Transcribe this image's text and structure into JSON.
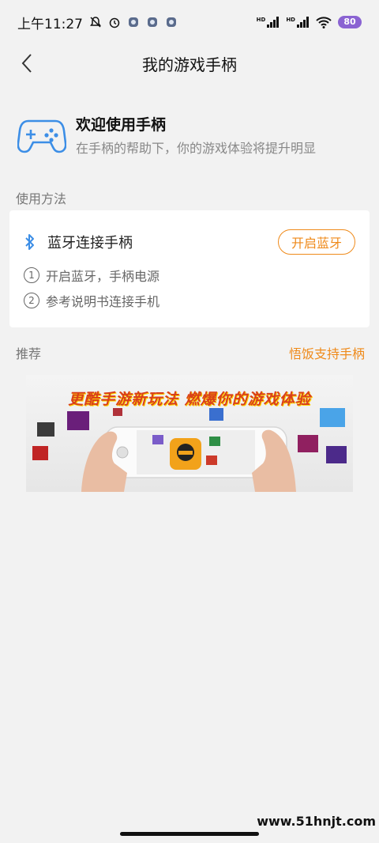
{
  "status_bar": {
    "time": "上午11:27",
    "network_badges": [
      "HD",
      "HD"
    ],
    "battery": "80"
  },
  "nav": {
    "title": "我的游戏手柄"
  },
  "welcome": {
    "title": "欢迎使用手柄",
    "subtitle": "在手柄的帮助下，你的游戏体验将提升明显"
  },
  "usage": {
    "section_label": "使用方法",
    "bluetooth_label": "蓝牙连接手柄",
    "bluetooth_button": "开启蓝牙",
    "steps": [
      {
        "num": "1",
        "text": "开启蓝牙，手柄电源"
      },
      {
        "num": "2",
        "text": "参考说明书连接手机"
      }
    ]
  },
  "recommend": {
    "section_label": "推荐",
    "link": "悟饭支持手柄",
    "banner_title": "更酷手游新玩法 燃爆你的游戏体验"
  },
  "watermark": "www.51hnjt.com",
  "colors": {
    "accent": "#ef8a1a",
    "icon_blue": "#3c8ee6",
    "background": "#f2f2f2"
  }
}
